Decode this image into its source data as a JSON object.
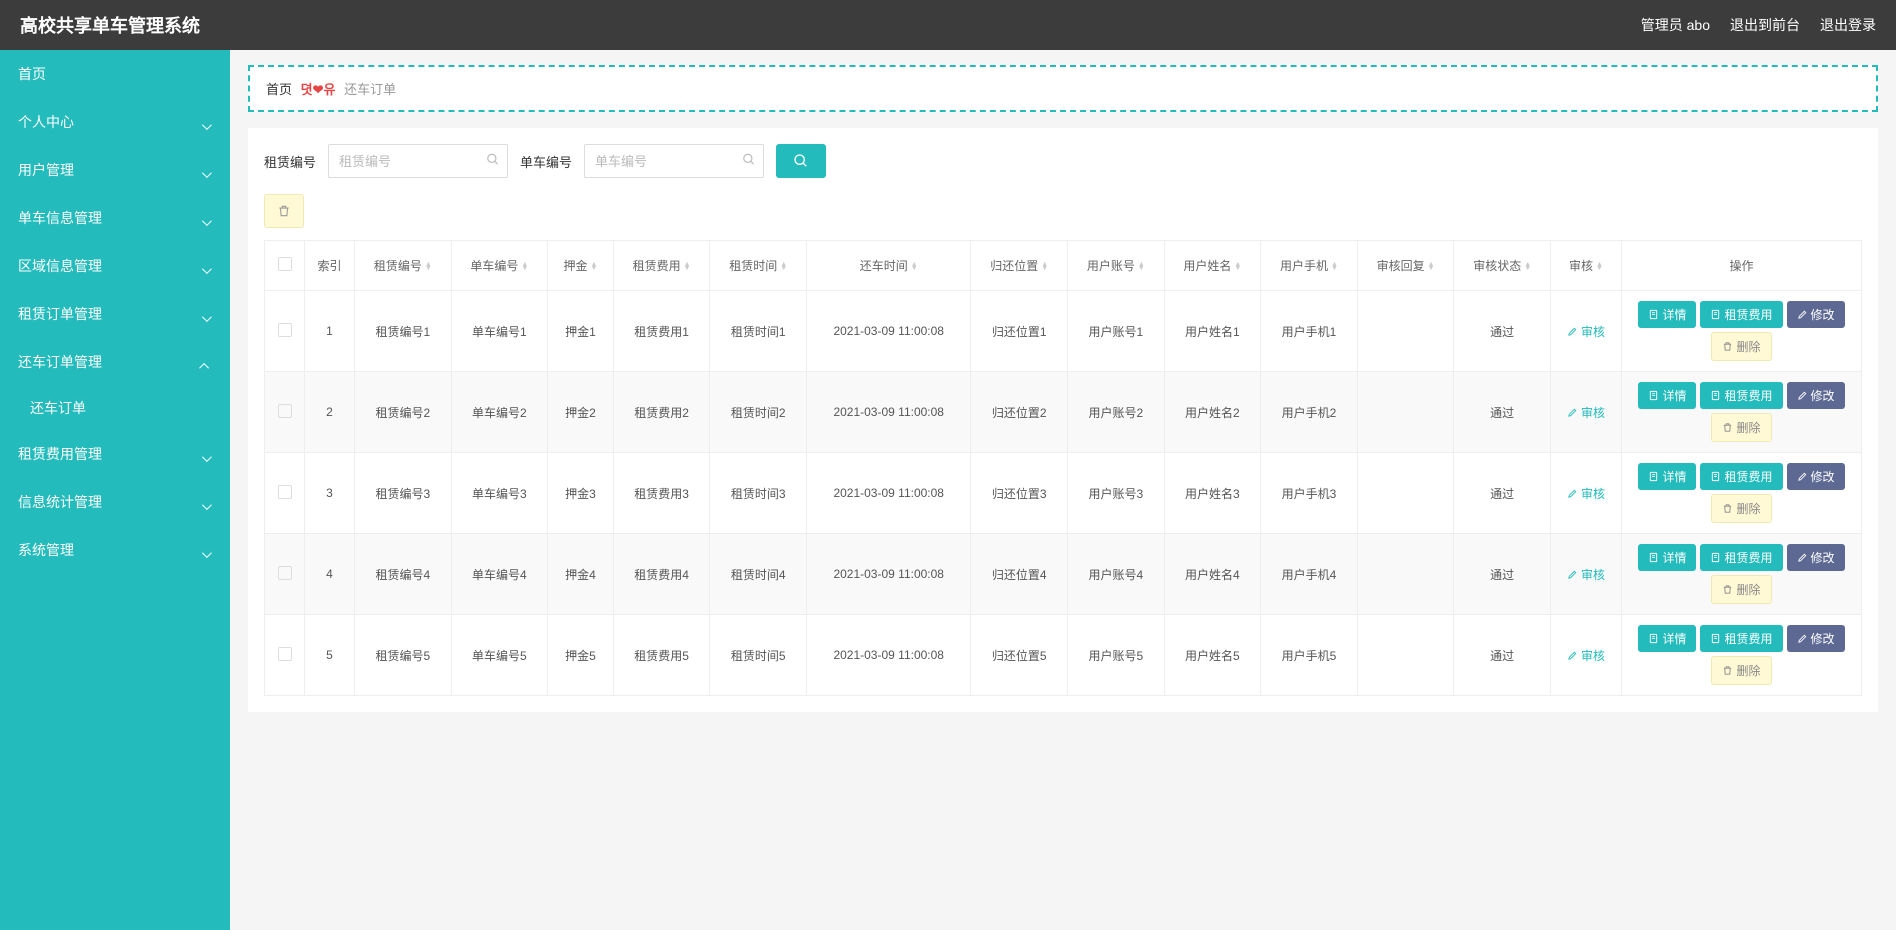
{
  "header": {
    "title": "高校共享单车管理系统",
    "userLabel": "管理员 abo",
    "exitFront": "退出到前台",
    "logout": "退出登录"
  },
  "sidebar": [
    {
      "label": "首页",
      "expand": null
    },
    {
      "label": "个人中心",
      "expand": "down"
    },
    {
      "label": "用户管理",
      "expand": "down"
    },
    {
      "label": "单车信息管理",
      "expand": "down"
    },
    {
      "label": "区域信息管理",
      "expand": "down"
    },
    {
      "label": "租赁订单管理",
      "expand": "down"
    },
    {
      "label": "还车订单管理",
      "expand": "up",
      "children": [
        {
          "label": "还车订单"
        }
      ]
    },
    {
      "label": "租赁费用管理",
      "expand": "down"
    },
    {
      "label": "信息统计管理",
      "expand": "down"
    },
    {
      "label": "系统管理",
      "expand": "down"
    }
  ],
  "breadcrumb": {
    "home": "首页",
    "sep": "뎟❤유",
    "current": "还车订单"
  },
  "search": {
    "label1": "租赁编号",
    "placeholder1": "租赁编号",
    "label2": "单车编号",
    "placeholder2": "单车编号"
  },
  "columns": {
    "index": "索引",
    "rentNo": "租赁编号",
    "bikeNo": "单车编号",
    "deposit": "押金",
    "rentFee": "租赁费用",
    "rentTime": "租赁时间",
    "returnTime": "还车时间",
    "returnLoc": "归还位置",
    "userAcc": "用户账号",
    "userName": "用户姓名",
    "userPhone": "用户手机",
    "reviewReply": "审核回复",
    "reviewStatus": "审核状态",
    "review": "审核",
    "ops": "操作"
  },
  "reviewBtn": "审核",
  "opBtns": {
    "detail": "详情",
    "fee": "租赁费用",
    "edit": "修改",
    "delete": "删除"
  },
  "rows": [
    {
      "idx": "1",
      "rentNo": "租赁编号1",
      "bikeNo": "单车编号1",
      "deposit": "押金1",
      "rentFee": "租赁费用1",
      "rentTime": "租赁时间1",
      "returnTime": "2021-03-09 11:00:08",
      "returnLoc": "归还位置1",
      "userAcc": "用户账号1",
      "userName": "用户姓名1",
      "userPhone": "用户手机1",
      "reviewReply": "",
      "reviewStatus": "通过"
    },
    {
      "idx": "2",
      "rentNo": "租赁编号2",
      "bikeNo": "单车编号2",
      "deposit": "押金2",
      "rentFee": "租赁费用2",
      "rentTime": "租赁时间2",
      "returnTime": "2021-03-09 11:00:08",
      "returnLoc": "归还位置2",
      "userAcc": "用户账号2",
      "userName": "用户姓名2",
      "userPhone": "用户手机2",
      "reviewReply": "",
      "reviewStatus": "通过"
    },
    {
      "idx": "3",
      "rentNo": "租赁编号3",
      "bikeNo": "单车编号3",
      "deposit": "押金3",
      "rentFee": "租赁费用3",
      "rentTime": "租赁时间3",
      "returnTime": "2021-03-09 11:00:08",
      "returnLoc": "归还位置3",
      "userAcc": "用户账号3",
      "userName": "用户姓名3",
      "userPhone": "用户手机3",
      "reviewReply": "",
      "reviewStatus": "通过"
    },
    {
      "idx": "4",
      "rentNo": "租赁编号4",
      "bikeNo": "单车编号4",
      "deposit": "押金4",
      "rentFee": "租赁费用4",
      "rentTime": "租赁时间4",
      "returnTime": "2021-03-09 11:00:08",
      "returnLoc": "归还位置4",
      "userAcc": "用户账号4",
      "userName": "用户姓名4",
      "userPhone": "用户手机4",
      "reviewReply": "",
      "reviewStatus": "通过"
    },
    {
      "idx": "5",
      "rentNo": "租赁编号5",
      "bikeNo": "单车编号5",
      "deposit": "押金5",
      "rentFee": "租赁费用5",
      "rentTime": "租赁时间5",
      "returnTime": "2021-03-09 11:00:08",
      "returnLoc": "归还位置5",
      "userAcc": "用户账号5",
      "userName": "用户姓名5",
      "userPhone": "用户手机5",
      "reviewReply": "",
      "reviewStatus": "通过"
    }
  ]
}
